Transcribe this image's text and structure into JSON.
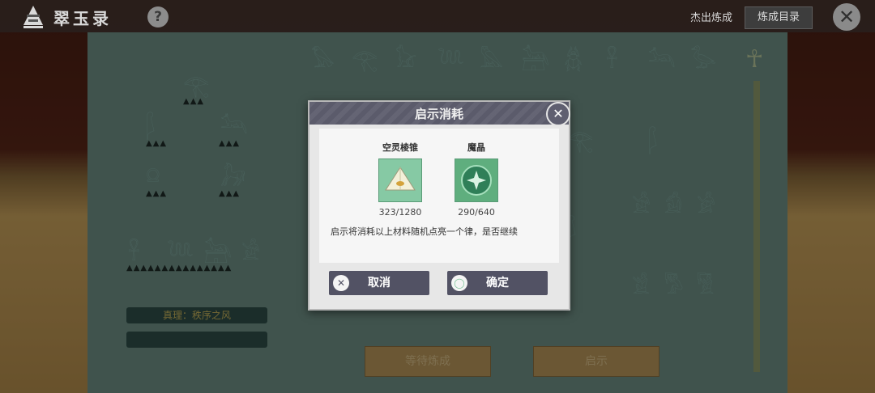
{
  "header": {
    "app_title": "翠玉录",
    "help_label": "?",
    "link_label": "杰出炼成",
    "catalog_button": "炼成目录",
    "close_label": "✕"
  },
  "left_panel": {
    "truth_label": "真理：秩序之风"
  },
  "bottom_actions": {
    "wait_label": "等待炼成",
    "reveal_label": "启示"
  },
  "dialog": {
    "title": "启示消耗",
    "close_label": "✕",
    "materials": [
      {
        "name": "空灵棱锥",
        "count": "323/1280"
      },
      {
        "name": "魔晶",
        "count": "290/640"
      }
    ],
    "message": "启示将消耗以上材料随机点亮一个律，是否继续",
    "cancel_label": "取消",
    "confirm_label": "确定"
  },
  "colors": {
    "dialog_header": "#5b5b6b",
    "stone": "#6e8f86",
    "gold_button": "#b8965a"
  }
}
